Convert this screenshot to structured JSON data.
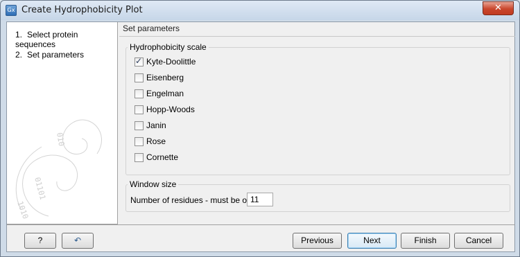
{
  "window": {
    "title": "Create Hydrophobicity Plot",
    "app_icon_text": "Gx",
    "close_label": "✕"
  },
  "steps": [
    {
      "number": "1.",
      "label": "Select protein sequences"
    },
    {
      "number": "2.",
      "label": "Set parameters"
    }
  ],
  "main": {
    "section_title": "Set parameters",
    "hydrophobicity": {
      "legend": "Hydrophobicity scale",
      "options": [
        {
          "label": "Kyte-Doolittle",
          "checked": true
        },
        {
          "label": "Eisenberg",
          "checked": false
        },
        {
          "label": "Engelman",
          "checked": false
        },
        {
          "label": "Hopp-Woods",
          "checked": false
        },
        {
          "label": "Janin",
          "checked": false
        },
        {
          "label": "Rose",
          "checked": false
        },
        {
          "label": "Cornette",
          "checked": false
        }
      ]
    },
    "window_size": {
      "legend": "Window size",
      "label": "Number of residues - must be odd:",
      "value": "11"
    }
  },
  "footer": {
    "help_label": "?",
    "reset_label": "↶",
    "previous_label": "Previous",
    "next_label": "Next",
    "finish_label": "Finish",
    "cancel_label": "Cancel"
  },
  "colors": {
    "window_frame": "#cfdbe8",
    "close_button": "#c9462c",
    "default_button_border": "#3c7fb1"
  }
}
